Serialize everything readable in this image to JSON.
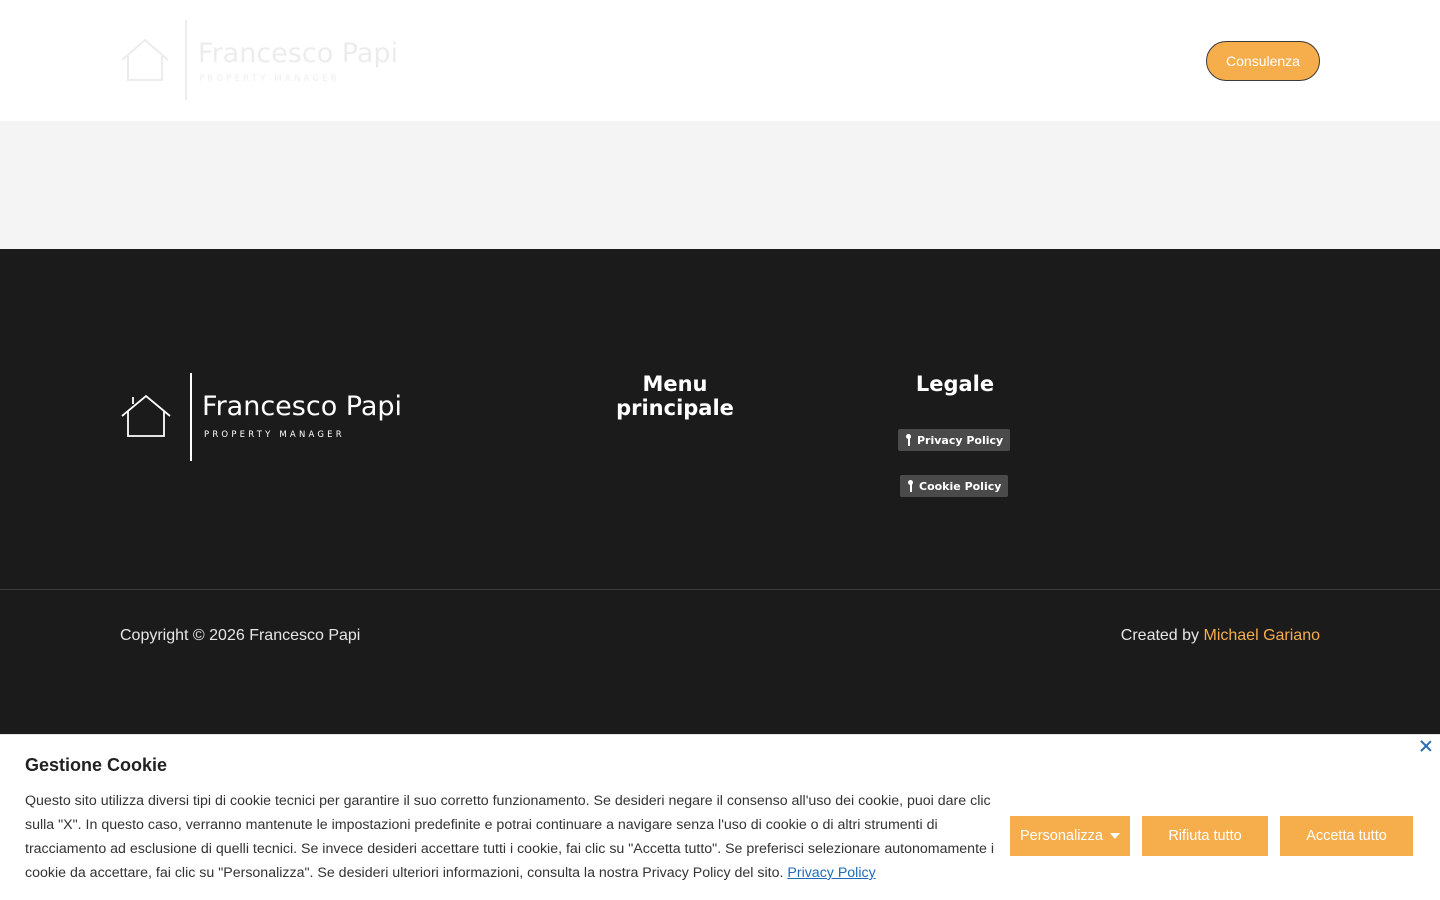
{
  "header": {
    "logo": {
      "name": "Francesco Papi",
      "subtitle": "PROPERTY MANAGER"
    },
    "cta_label": "Consulenza",
    "accent_color": "#f6ad4c"
  },
  "footer": {
    "logo": {
      "name": "Francesco Papi",
      "subtitle": "PROPERTY MANAGER"
    },
    "menu_title": "Menu principale",
    "legal_title": "Legale",
    "legal_links": [
      "Privacy Policy",
      "Cookie Policy"
    ],
    "copyright": "Copyright © 2026 Francesco Papi",
    "credit_prefix": "Created by ",
    "credit_name": "Michael Gariano",
    "background_color": "#1b1b1b"
  },
  "cookie_banner": {
    "title": "Gestione Cookie",
    "text": "Questo sito utilizza diversi tipi di cookie tecnici per garantire il suo corretto funzionamento. Se desideri negare il consenso all'uso dei cookie, puoi dare clic sulla \"X\". In questo caso, verranno mantenute le impostazioni predefinite e potrai continuare a navigare senza l'uso di cookie o di altri strumenti di tracciamento ad esclusione di quelli tecnici. Se invece desideri accettare tutti i cookie, fai clic su \"Accetta tutto\". Se preferisci selezionare autonomamente i cookie da accettare, fai clic su \"Personalizza\". Se desideri ulteriori informazioni, consulta la nostra Privacy Policy del sito.",
    "privacy_link": "Privacy Policy",
    "buttons": {
      "customize": "Personalizza",
      "reject": "Rifiuta tutto",
      "accept": "Accetta tutto"
    },
    "close_icon": "close-icon"
  }
}
